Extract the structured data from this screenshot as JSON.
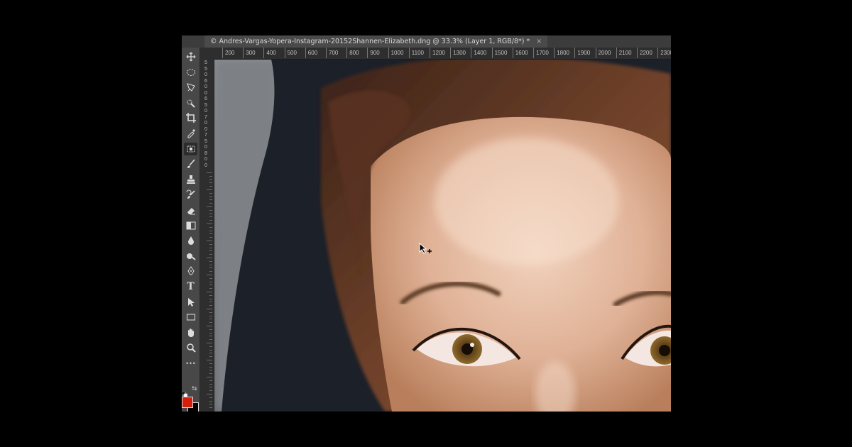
{
  "document": {
    "tab_title": "© Andres-Vargas-Yopera-Instagram-20152Shannen-Elizabeth.dng @ 33.3% (Layer 1, RGB/8*) *",
    "close_glyph": "×"
  },
  "ruler": {
    "top_labels": [
      "200",
      "300",
      "400",
      "500",
      "600",
      "700",
      "800",
      "900",
      "1000",
      "1100",
      "1200",
      "1300",
      "1400",
      "1500",
      "1600",
      "1700",
      "1800",
      "1900",
      "2000",
      "2100",
      "2200",
      "2300"
    ],
    "left_labels": [
      "5",
      "5",
      "0",
      "6",
      "0",
      "0",
      "6",
      "5",
      "0",
      "7",
      "0",
      "0",
      "7",
      "5",
      "0",
      "8",
      "0",
      "0"
    ]
  },
  "toolbar": {
    "tools": [
      {
        "name": "move-tool",
        "icon": "move-icon"
      },
      {
        "name": "marquee-tool",
        "icon": "ellipse-marquee-icon"
      },
      {
        "name": "lasso-tool",
        "icon": "polygonal-lasso-icon"
      },
      {
        "name": "quick-selection-tool",
        "icon": "quick-selection-icon"
      },
      {
        "name": "crop-tool",
        "icon": "crop-icon"
      },
      {
        "name": "eyedropper-tool",
        "icon": "eyedropper-icon"
      },
      {
        "name": "patch-tool",
        "icon": "patch-icon",
        "active": true
      },
      {
        "name": "brush-tool",
        "icon": "brush-icon"
      },
      {
        "name": "clone-stamp-tool",
        "icon": "stamp-icon"
      },
      {
        "name": "history-brush-tool",
        "icon": "history-brush-icon"
      },
      {
        "name": "eraser-tool",
        "icon": "eraser-icon"
      },
      {
        "name": "gradient-tool",
        "icon": "gradient-icon"
      },
      {
        "name": "blur-tool",
        "icon": "drop-icon"
      },
      {
        "name": "dodge-tool",
        "icon": "dodge-icon"
      },
      {
        "name": "pen-tool",
        "icon": "pen-icon"
      },
      {
        "name": "type-tool",
        "icon": "type-icon",
        "glyph": "T"
      },
      {
        "name": "path-selection-tool",
        "icon": "arrow-icon"
      },
      {
        "name": "rectangle-tool",
        "icon": "rectangle-icon"
      },
      {
        "name": "hand-tool",
        "icon": "hand-icon"
      },
      {
        "name": "zoom-tool",
        "icon": "zoom-icon"
      },
      {
        "name": "edit-toolbar",
        "icon": "more-icon",
        "glyph": "•••"
      }
    ],
    "foreground_color": "#d41f0c",
    "background_color": "#000000"
  }
}
